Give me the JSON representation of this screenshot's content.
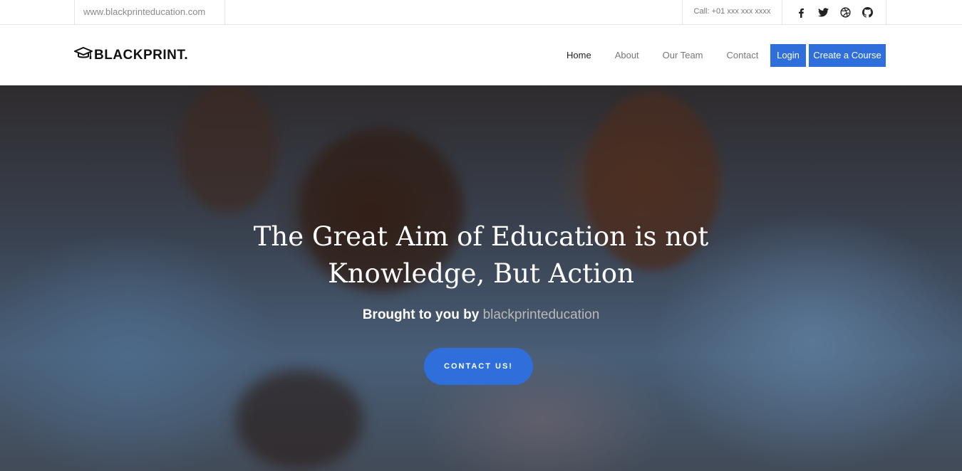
{
  "topbar": {
    "site_url": "www.blackprinteducation.com",
    "call_text": "Call: +01 xxx xxx xxxx",
    "socials": [
      "facebook-icon",
      "twitter-icon",
      "dribbble-icon",
      "github-icon"
    ]
  },
  "brand": {
    "name": "BLACKPRINT.",
    "logo_icon": "graduation-cap-icon"
  },
  "nav": {
    "items": [
      {
        "label": "Home",
        "active": true
      },
      {
        "label": "About",
        "active": false
      },
      {
        "label": "Our Team",
        "active": false
      },
      {
        "label": "Contact",
        "active": false
      }
    ],
    "login_label": "Login",
    "create_course_label": "Create a Course"
  },
  "hero": {
    "title_line1": "The Great Aim of Education is not",
    "title_line2": "Knowledge, But Action",
    "subtitle_prefix": "Brought to you by",
    "subtitle_brand": "blackprinteducation",
    "cta_label": "CONTACT US!"
  },
  "colors": {
    "accent": "#2e6fdc",
    "text_dark": "#222222",
    "text_muted": "#777777"
  }
}
